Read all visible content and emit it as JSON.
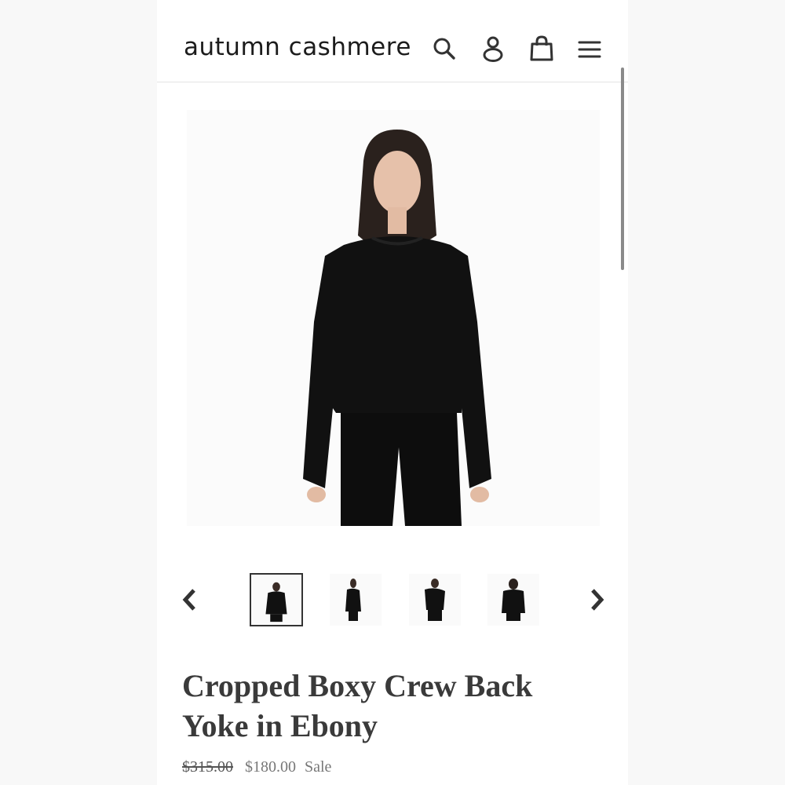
{
  "header": {
    "brand": "autumn cashmere",
    "icons": [
      "search-icon",
      "account-icon",
      "cart-icon",
      "menu-icon"
    ]
  },
  "product": {
    "title_line1": "Cropped Boxy Crew Back",
    "title_line2": "Yoke in Ebony",
    "price_original": "$315.00",
    "price_sale": "$180.00",
    "sale_label": "Sale"
  },
  "gallery": {
    "thumbnail_count": 4,
    "active_index": 0
  },
  "colors": {
    "text": "#3a3a3a",
    "brand": "#1c1c1c",
    "sweater": "#111111",
    "background": "#ffffff"
  }
}
